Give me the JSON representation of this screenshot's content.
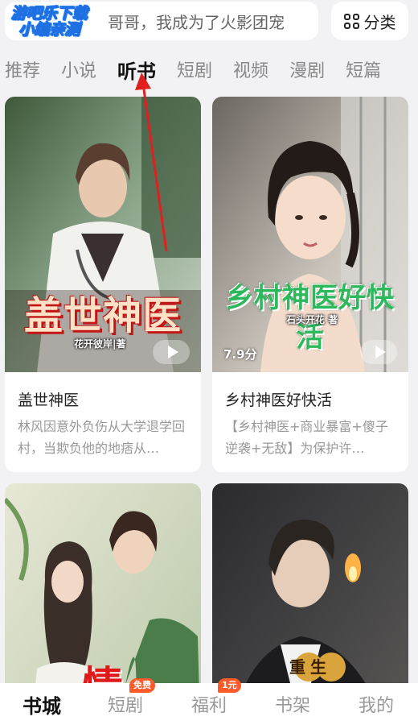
{
  "search": {
    "placeholder_text": "哥哥，我成为了火影团宠"
  },
  "watermark": {
    "line1": "游吧乐下载",
    "line2": "小编亲测"
  },
  "category_button": {
    "label": "分类",
    "icon": "grid-icon"
  },
  "tabs": [
    {
      "label": "推荐",
      "active": false
    },
    {
      "label": "小说",
      "active": false
    },
    {
      "label": "听书",
      "active": true
    },
    {
      "label": "短剧",
      "active": false
    },
    {
      "label": "视频",
      "active": false
    },
    {
      "label": "漫剧",
      "active": false
    },
    {
      "label": "短篇",
      "active": false
    }
  ],
  "books": [
    {
      "cover_title": "盖世神医",
      "cover_author": "花开彼岸|著",
      "title": "盖世神医",
      "description": "林风因意外负伤从大学退学回村，当欺负他的地痞从…",
      "has_play": true
    },
    {
      "cover_title": "乡村神医好快活",
      "cover_author": "石头开花 著",
      "score": "7.9分",
      "title": "乡村神医好快活",
      "description": "【乡村神医+商业暴富+傻子逆袭+无敌】为保护许…",
      "has_play": true
    },
    {
      "cover_title": "情",
      "title": "",
      "description": ""
    },
    {
      "cover_badge": "重生",
      "title": "",
      "description": ""
    }
  ],
  "bottom_nav": [
    {
      "label": "书城",
      "active": true
    },
    {
      "label": "短剧",
      "badge": "免费"
    },
    {
      "label": "福利",
      "badge": "1元"
    },
    {
      "label": "书架"
    },
    {
      "label": "我的"
    }
  ],
  "colors": {
    "background": "#f2f2f4",
    "badge": "#ff5a2a",
    "annotation_arrow": "#e02020",
    "watermark": "#2b86ff"
  }
}
